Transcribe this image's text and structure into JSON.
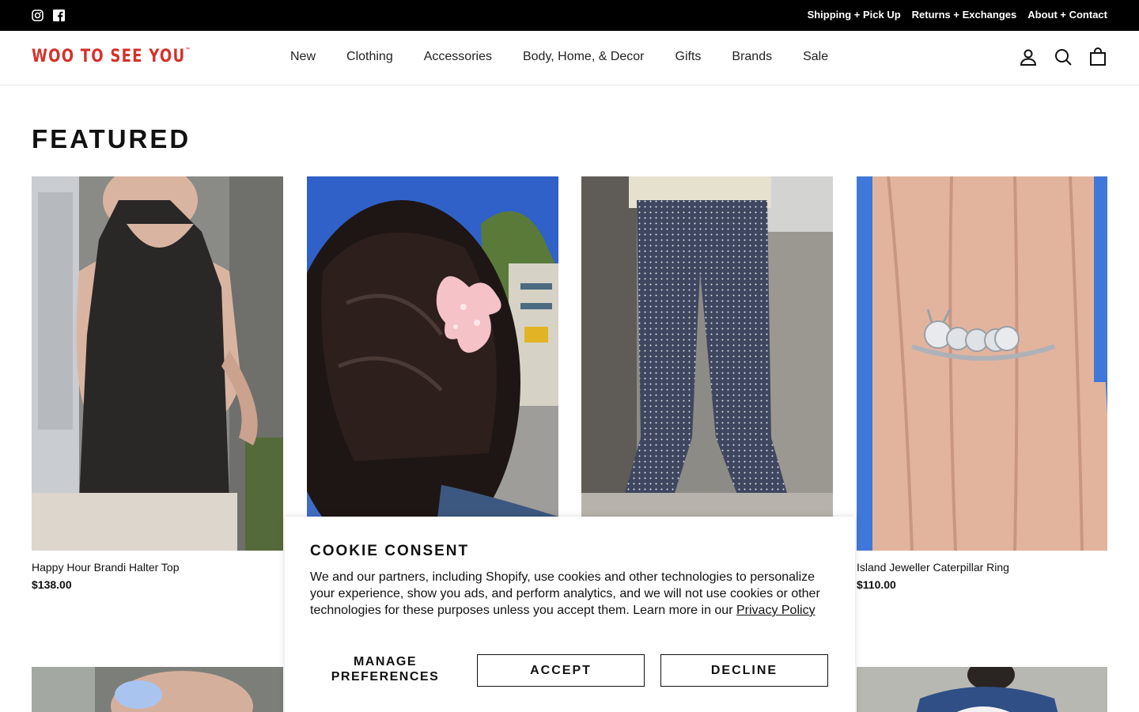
{
  "topbar": {
    "social": [
      "instagram-icon",
      "facebook-icon"
    ],
    "links": [
      "Shipping + Pick Up",
      "Returns + Exchanges",
      "About + Contact"
    ]
  },
  "header": {
    "logo": "WOO TO SEE YOU",
    "logo_mark": "™",
    "nav": [
      "New",
      "Clothing",
      "Accessories",
      "Body, Home, & Decor",
      "Gifts",
      "Brands",
      "Sale"
    ],
    "icons": [
      "account-icon",
      "search-icon",
      "cart-icon"
    ]
  },
  "featured": {
    "title": "FEATURED",
    "products": [
      {
        "name": "Happy Hour Brandi Halter Top",
        "price": "$138.00"
      },
      {
        "name": "",
        "price": ""
      },
      {
        "name": "",
        "price": ""
      },
      {
        "name": "Island Jeweller Caterpillar Ring",
        "price": "$110.00"
      }
    ]
  },
  "cookie": {
    "title": "COOKIE CONSENT",
    "body": "We and our partners, including Shopify, use cookies and other technologies to personalize your experience, show you ads, and perform analytics, and we will not use cookies or other technologies for these purposes unless you accept them. Learn more in our ",
    "policy_link": "Privacy Policy",
    "manage": "MANAGE PREFERENCES",
    "accept": "ACCEPT",
    "decline": "DECLINE"
  },
  "colors": {
    "brand": "#d6312b",
    "topbar_bg": "#000000"
  }
}
